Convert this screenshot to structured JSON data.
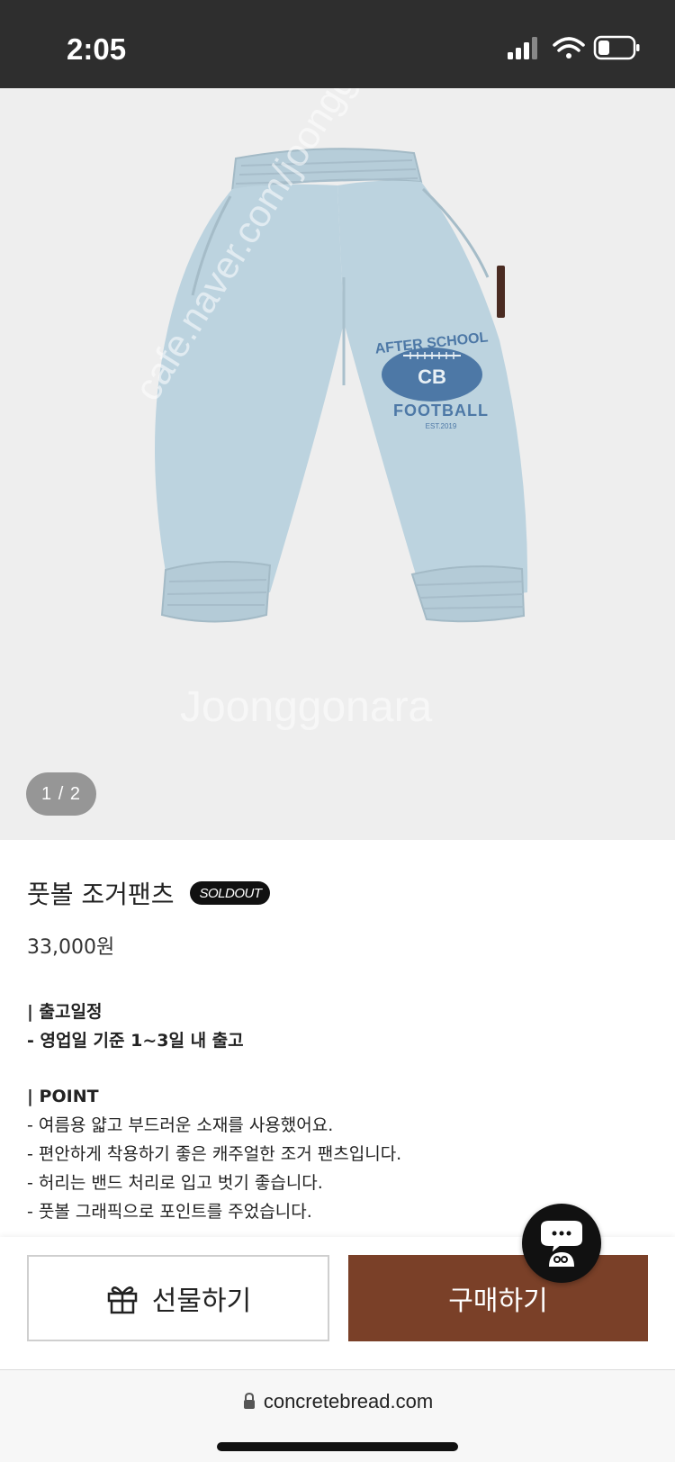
{
  "status_bar": {
    "time": "2:05",
    "icons": [
      "cellular-signal-icon",
      "wifi-icon",
      "battery-icon"
    ]
  },
  "product_image": {
    "counter": "1 / 2",
    "watermark_lines": [
      "cafe.naver.com/joonggonara",
      "Joonggonara"
    ],
    "graphic_text": {
      "top": "AFTER SCHOOL",
      "center": "CB",
      "bottom": "FOOTBALL",
      "small": "EST.2019"
    }
  },
  "product": {
    "title": "풋볼 조거팬츠",
    "badge": "SOLDOUT",
    "price": "33,000원"
  },
  "details": {
    "shipping_heading": "| 출고일정",
    "shipping_line": "- 영업일 기준 1~3일 내 출고",
    "point_heading": "| POINT",
    "point_lines": [
      "- 여름용 얇고 부드러운 소재를 사용했어요.",
      "- 편안하게 착용하기 좋은 캐주얼한 조거 팬츠입니다.",
      "- 허리는 밴드 처리로 입고 벗기 좋습니다.",
      "- 풋볼 그래픽으로 포인트를 주었습니다."
    ]
  },
  "actions": {
    "gift_label": "선물하기",
    "buy_label": "구매하기"
  },
  "url_bar": {
    "url": "concretebread.com"
  },
  "colors": {
    "status_bar": "#2e2e2e",
    "buy_button": "#7a4028",
    "image_bg": "#eeeeee",
    "pants": "#bcd3df"
  }
}
